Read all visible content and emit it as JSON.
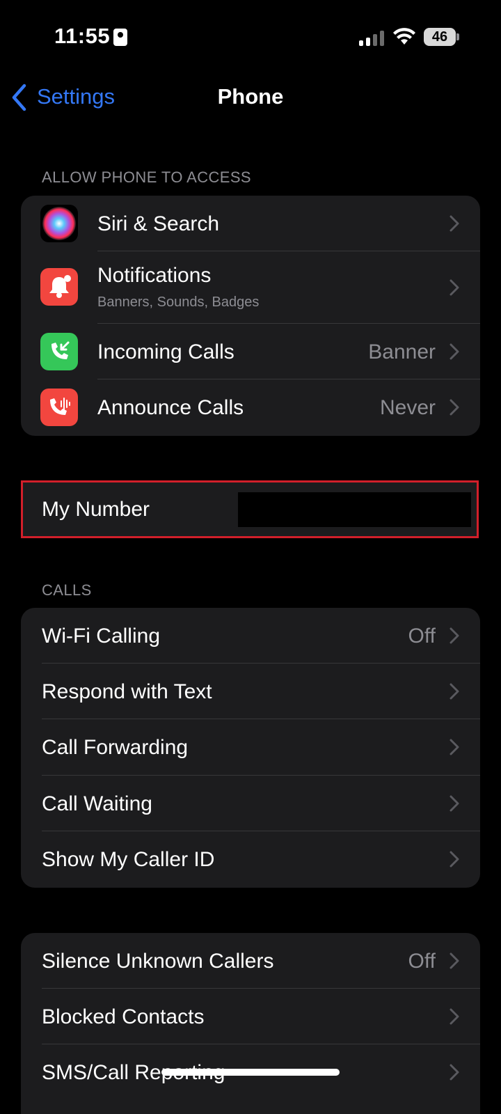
{
  "status": {
    "time": "11:55",
    "battery": "46"
  },
  "nav": {
    "back_label": "Settings",
    "title": "Phone"
  },
  "access": {
    "header": "ALLOW PHONE TO ACCESS",
    "items": [
      {
        "label": "Siri & Search",
        "icon": "siri-icon"
      },
      {
        "label": "Notifications",
        "sub": "Banners, Sounds, Badges",
        "icon": "notifications-icon"
      },
      {
        "label": "Incoming Calls",
        "value": "Banner",
        "icon": "incoming-calls-icon"
      },
      {
        "label": "Announce Calls",
        "value": "Never",
        "icon": "announce-calls-icon"
      }
    ]
  },
  "my_number": {
    "label": "My Number"
  },
  "calls": {
    "header": "CALLS",
    "items": [
      {
        "label": "Wi-Fi Calling",
        "value": "Off"
      },
      {
        "label": "Respond with Text"
      },
      {
        "label": "Call Forwarding"
      },
      {
        "label": "Call Waiting"
      },
      {
        "label": "Show My Caller ID"
      }
    ]
  },
  "blocking": {
    "items": [
      {
        "label": "Silence Unknown Callers",
        "value": "Off"
      },
      {
        "label": "Blocked Contacts"
      },
      {
        "label": "SMS/Call Reporting"
      }
    ]
  },
  "colors": {
    "accent": "#3478f6",
    "background": "#000000",
    "cell": "#1c1c1e",
    "secondary_text": "#8d8d93",
    "highlight_border": "#d21f2a",
    "notifications_icon": "#f2463f",
    "incoming_calls_icon": "#35c759",
    "announce_calls_icon": "#f2463f"
  }
}
